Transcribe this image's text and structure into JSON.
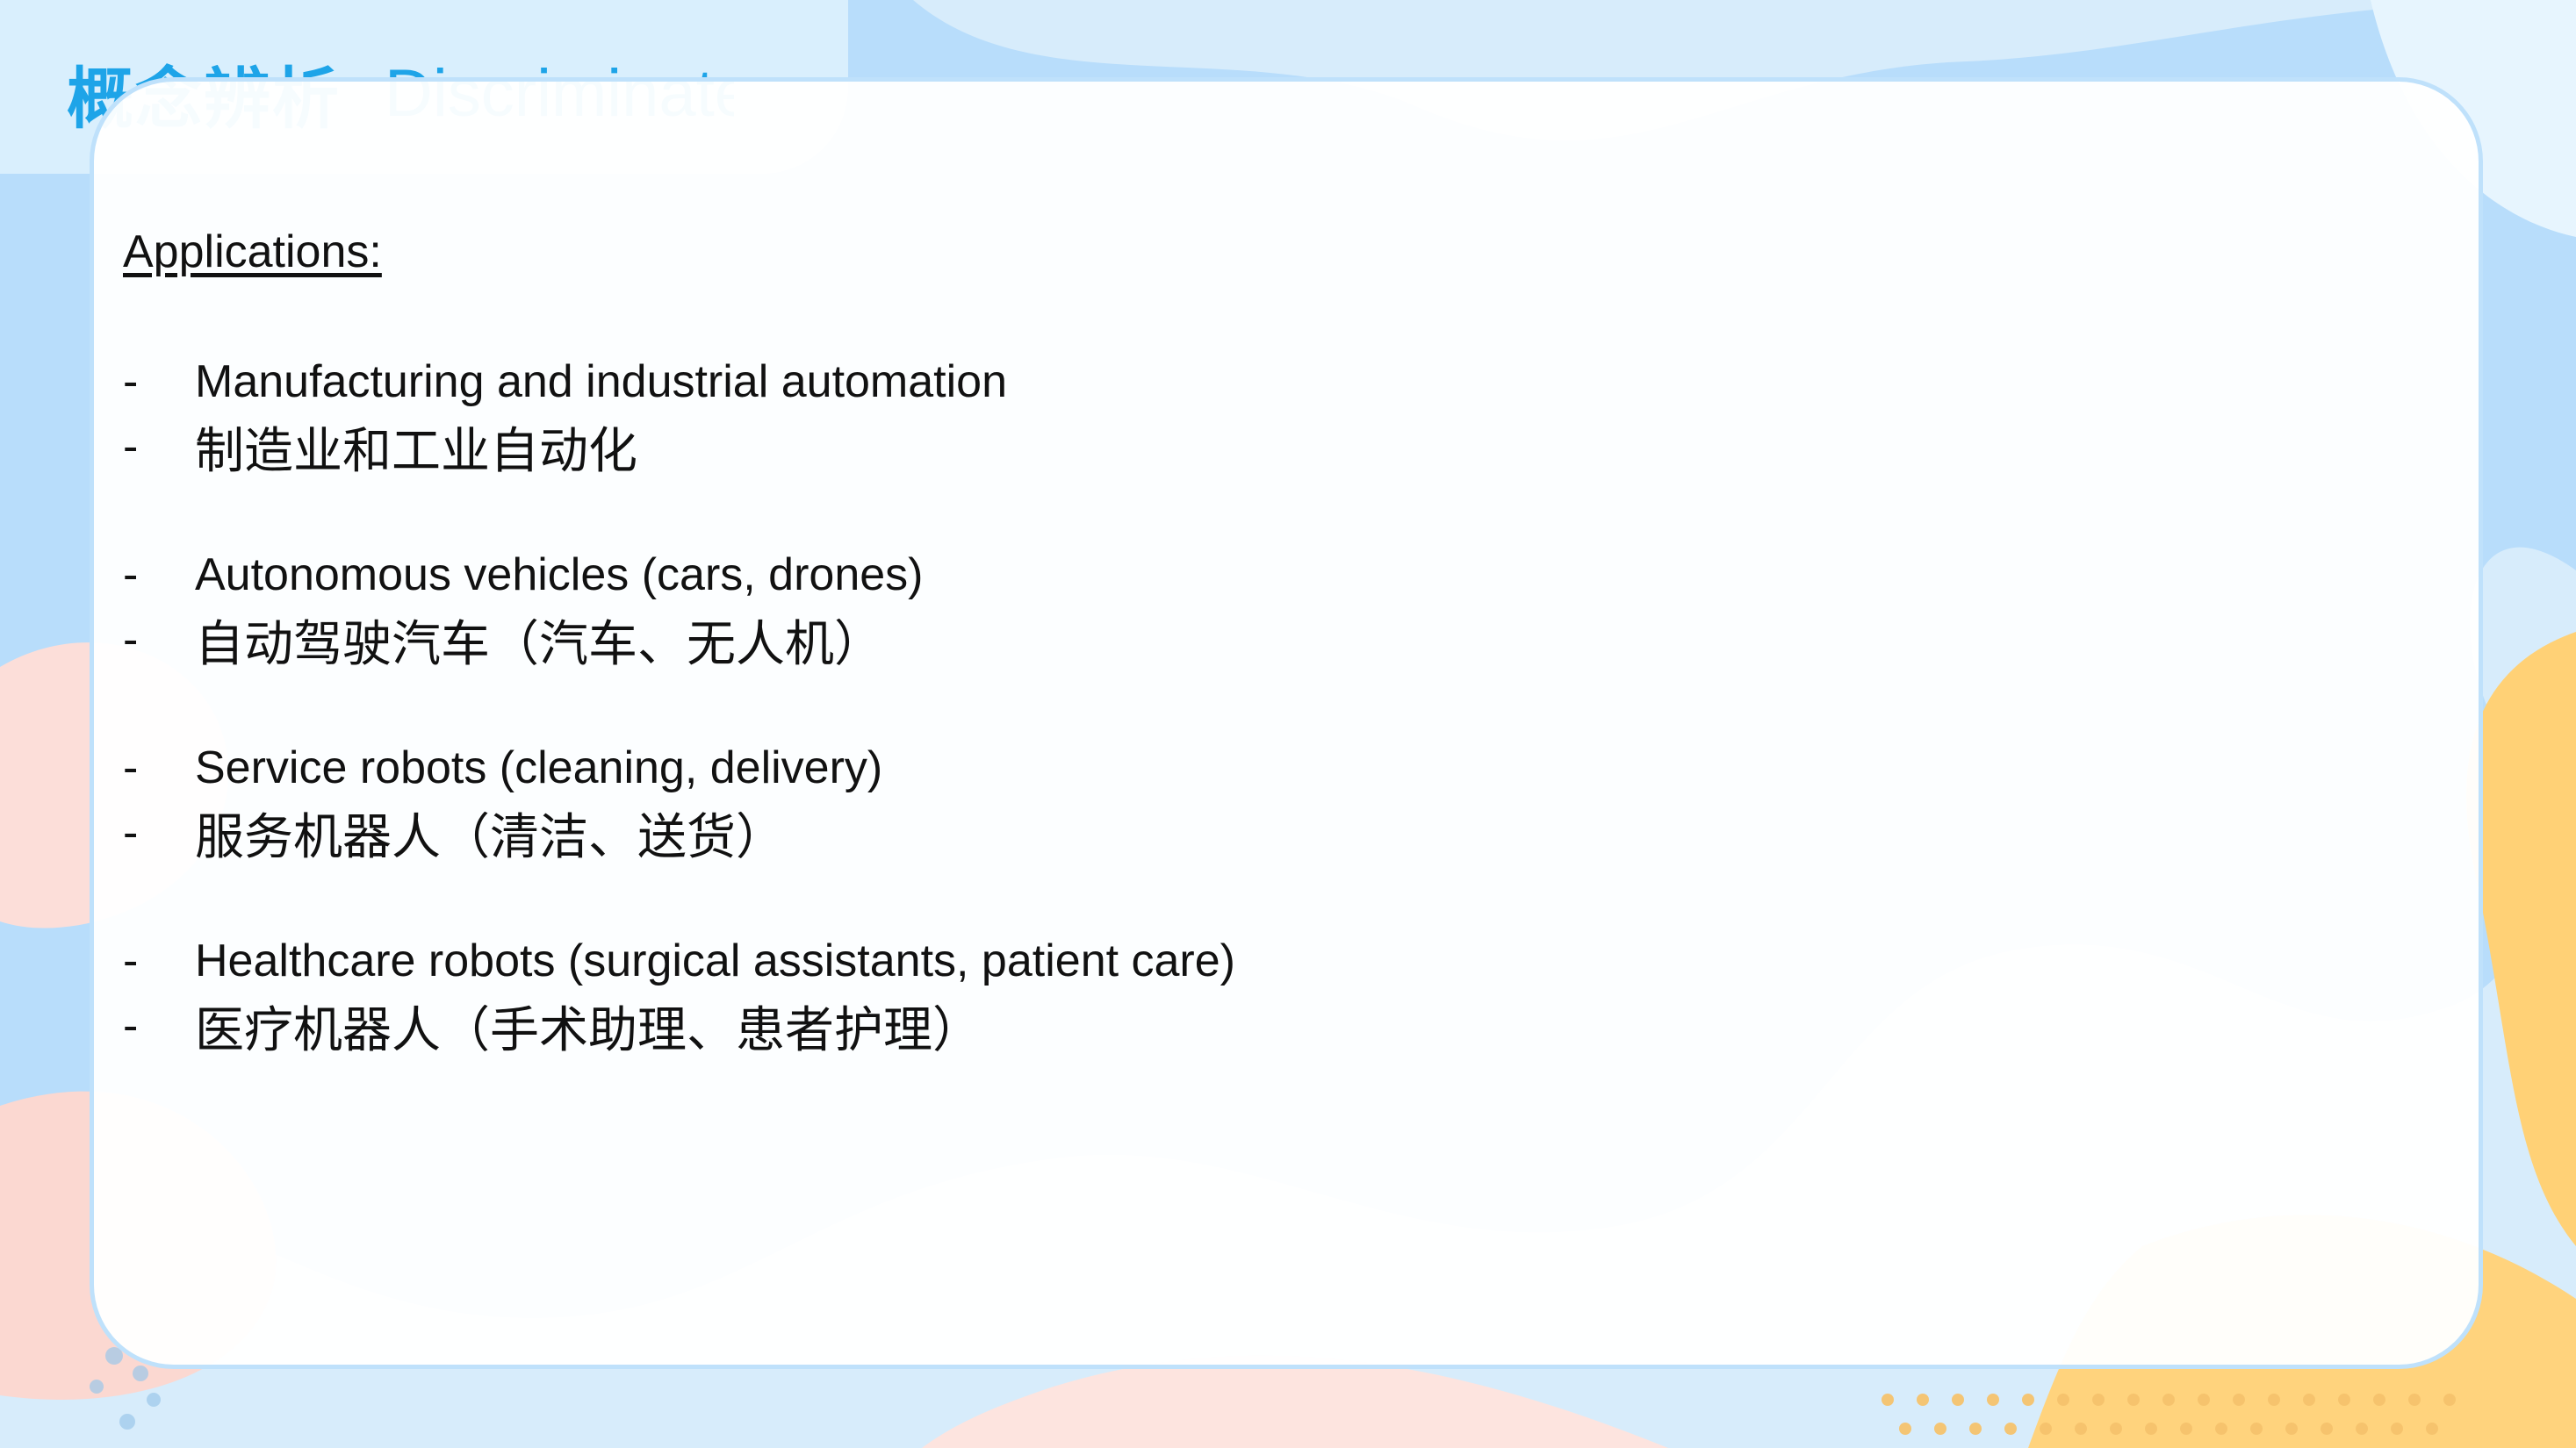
{
  "title": {
    "cn": "概念辨析",
    "en": "Discriminate"
  },
  "content": {
    "heading": "Applications:",
    "items": [
      {
        "en": "Manufacturing and industrial automation",
        "cn": "制造业和工业自动化"
      },
      {
        "en": "Autonomous vehicles (cars, drones)",
        "cn": "自动驾驶汽车（汽车、无人机）"
      },
      {
        "en": "Service robots (cleaning, delivery)",
        "cn": "服务机器人（清洁、送货）"
      },
      {
        "en": "Healthcare robots (surgical assistants, patient care)",
        "cn": "医疗机器人（手术助理、患者护理）"
      }
    ],
    "bullet": "-"
  },
  "colors": {
    "title": "#1ea4e8",
    "background_blue": "#cfe7fb",
    "background_pink": "#fde2df",
    "background_yellow": "#ffd27a",
    "card_border": "#bfe1fb"
  }
}
